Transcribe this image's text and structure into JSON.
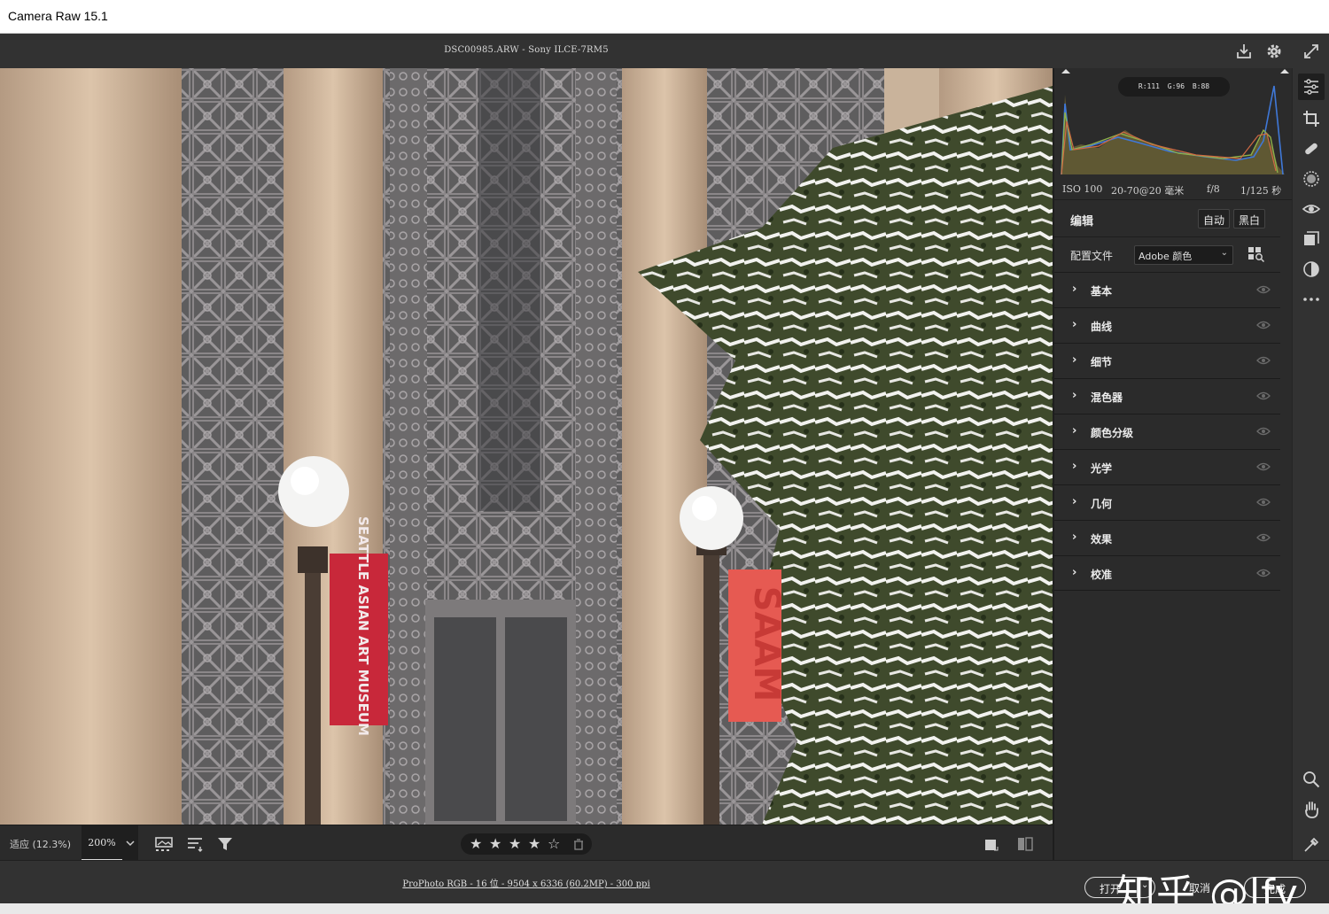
{
  "window": {
    "title": "Camera Raw 15.1"
  },
  "topbar": {
    "filename": "DSC00985.ARW -  Sony ILCE-7RM5"
  },
  "photo": {
    "banner_left_text": "SEATTLE ASIAN ART MUSEUM",
    "banner_right_text": "SAAM"
  },
  "viewbar": {
    "zoom_fit": "适应 (12.3%)",
    "zoom_value": "200%",
    "stars": [
      "★",
      "★",
      "★",
      "★",
      "☆"
    ]
  },
  "histogram": {
    "readout": "R:111  G:96  B:88",
    "iso": "ISO 100",
    "lens": "20-70@20 毫米",
    "aperture": "f/8",
    "shutter": "1/125 秒"
  },
  "edit": {
    "title": "编辑",
    "auto": "自动",
    "bw": "黑白",
    "profile_label": "配置文件",
    "profile_value": "Adobe 颜色"
  },
  "sections": [
    {
      "label": "基本"
    },
    {
      "label": "曲线"
    },
    {
      "label": "细节"
    },
    {
      "label": "混色器"
    },
    {
      "label": "颜色分级"
    },
    {
      "label": "光学"
    },
    {
      "label": "几何"
    },
    {
      "label": "效果"
    },
    {
      "label": "校准"
    }
  ],
  "footer": {
    "color_info": "ProPhoto RGB - 16 位 - 9504 x 6336 (60.2MP) - 300 ppi",
    "open": "打开",
    "cancel": "取消",
    "done": "完成"
  },
  "watermark": "知乎 @lfy"
}
